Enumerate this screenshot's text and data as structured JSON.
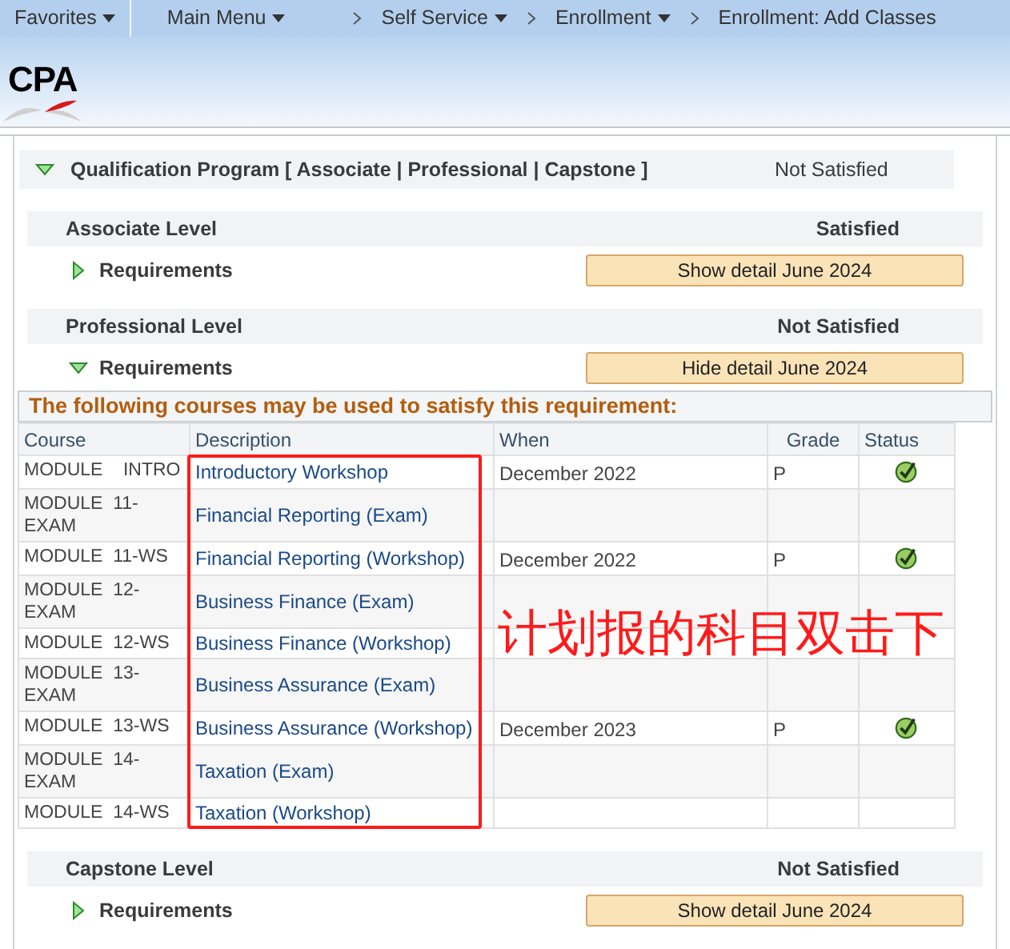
{
  "nav": {
    "favorites": {
      "label": "Favorites",
      "dropdown": true
    },
    "breadcrumbs": [
      {
        "label": "Main Menu",
        "dropdown": true
      },
      {
        "label": "Self Service",
        "dropdown": true
      },
      {
        "label": "Enrollment",
        "dropdown": true
      },
      {
        "label": "Enrollment: Add Classes",
        "dropdown": false
      }
    ]
  },
  "logo": {
    "text": "CPA"
  },
  "program": {
    "title": "Qualification Program [ Associate | Professional | Capstone ]",
    "status": "Not Satisfied",
    "expanded": true
  },
  "levels": [
    {
      "name": "Associate Level",
      "status": "Satisfied",
      "requirements": {
        "label": "Requirements",
        "expanded": false,
        "button": "Show detail June 2024"
      }
    },
    {
      "name": "Professional Level",
      "status": "Not Satisfied",
      "requirements": {
        "label": "Requirements",
        "expanded": true,
        "button": "Hide detail June 2024",
        "detail": {
          "heading": "The following courses may be used to satisfy this requirement:",
          "columns": [
            "Course",
            "Description",
            "When",
            "Grade",
            "Status"
          ],
          "rows": [
            {
              "course": "MODULE    INTRO",
              "description": "Introductory Workshop",
              "when": "December 2022",
              "grade": "P",
              "completed": true
            },
            {
              "course": "MODULE  11-EXAM",
              "description": "Financial Reporting (Exam)",
              "completed": false
            },
            {
              "course": "MODULE  11-WS",
              "description": "Financial Reporting (Workshop)",
              "when": "December 2022",
              "grade": "P",
              "completed": true
            },
            {
              "course": "MODULE  12-EXAM",
              "description": "Business Finance (Exam)",
              "completed": false
            },
            {
              "course": "MODULE  12-WS",
              "description": "Business Finance (Workshop)",
              "completed": false
            },
            {
              "course": "MODULE  13-EXAM",
              "description": "Business Assurance (Exam)",
              "completed": false
            },
            {
              "course": "MODULE  13-WS",
              "description": "Business Assurance (Workshop)",
              "when": "December 2023",
              "grade": "P",
              "completed": true
            },
            {
              "course": "MODULE  14-EXAM",
              "description": "Taxation (Exam)",
              "completed": false
            },
            {
              "course": "MODULE  14-WS",
              "description": "Taxation (Workshop)",
              "completed": false
            }
          ]
        }
      }
    },
    {
      "name": "Capstone Level",
      "status": "Not Satisfied",
      "requirements": {
        "label": "Requirements",
        "expanded": false,
        "button": "Show detail June 2024"
      }
    }
  ],
  "annotation": {
    "text": "计划报的科目双击下"
  }
}
